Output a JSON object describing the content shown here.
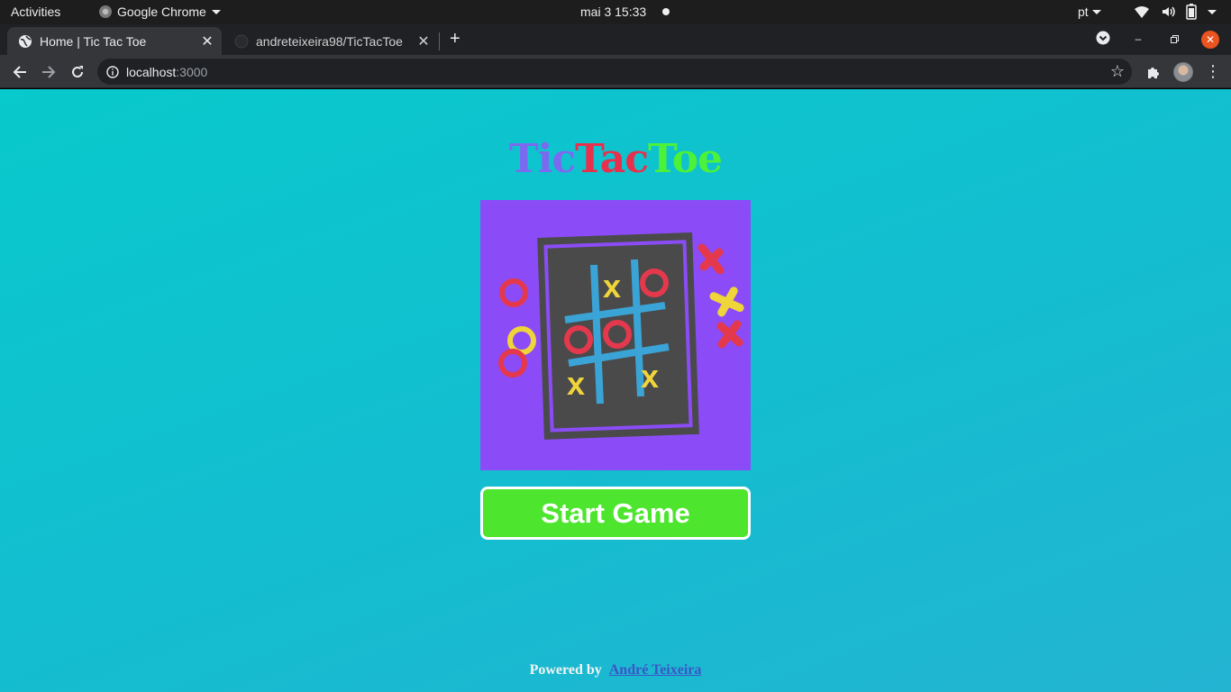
{
  "os_bar": {
    "activities": "Activities",
    "app_name": "Google Chrome",
    "clock": "mai 3  15:33",
    "input_lang": "pt"
  },
  "browser": {
    "tabs": [
      {
        "title": "Home | Tic Tac Toe",
        "active": true,
        "icon": "globe-icon"
      },
      {
        "title": "andreteixeira98/TicTacToe",
        "active": false,
        "icon": "github-icon"
      }
    ],
    "url_host": "localhost",
    "url_port": ":3000"
  },
  "page": {
    "logo": {
      "part1": "Tic",
      "part2": "Tac",
      "part3": "Toe"
    },
    "colors": {
      "background": "#0bc7cd",
      "tic": "#7d69f0",
      "tac": "#e8304c",
      "toe": "#4cf13a",
      "hero_bg": "#8b4cf8",
      "button": "#4de52e"
    },
    "start_button": "Start Game",
    "footer": {
      "powered_by": "Powered by",
      "author": "André Teixeira"
    }
  }
}
